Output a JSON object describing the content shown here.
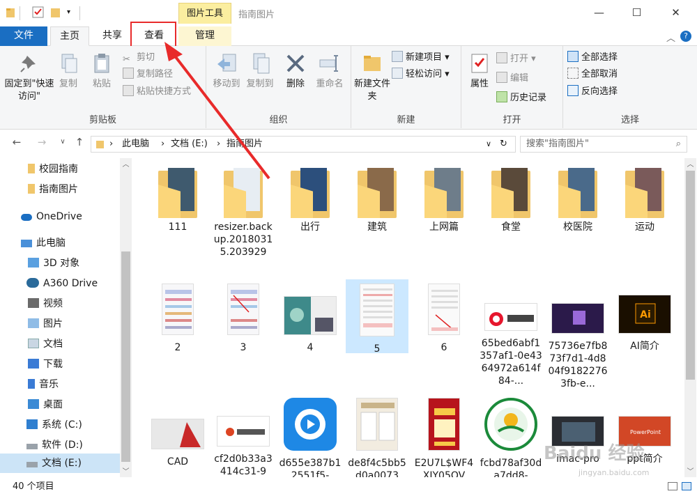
{
  "title_bar": {
    "context_tab": "图片工具",
    "window_title": "指南图片",
    "minimize": "—",
    "maximize": "☐",
    "close": "✕"
  },
  "tabs": {
    "file": "文件",
    "home": "主页",
    "share": "共享",
    "view": "查看",
    "manage": "管理"
  },
  "ribbon": {
    "clipboard": {
      "label": "剪贴板",
      "pin": "固定到\"快速访问\"",
      "copy": "复制",
      "paste": "粘贴",
      "cut": "剪切",
      "copy_path": "复制路径",
      "paste_shortcut": "粘贴快捷方式"
    },
    "organize": {
      "label": "组织",
      "move_to": "移动到",
      "copy_to": "复制到",
      "delete": "删除",
      "rename": "重命名"
    },
    "new": {
      "label": "新建",
      "new_folder": "新建文件夹",
      "new_item": "新建项目",
      "easy_access": "轻松访问"
    },
    "open": {
      "label": "打开",
      "properties": "属性",
      "open": "打开",
      "edit": "编辑",
      "history": "历史记录"
    },
    "select": {
      "label": "选择",
      "select_all": "全部选择",
      "select_none": "全部取消",
      "invert": "反向选择"
    }
  },
  "address": {
    "crumbs": [
      "此电脑",
      "文档 (E:)",
      "指南图片"
    ],
    "search_placeholder": "搜索\"指南图片\""
  },
  "nav": [
    {
      "label": "校园指南",
      "icon": "folder-icon"
    },
    {
      "label": "指南图片",
      "icon": "folder-icon"
    },
    {
      "label": "OneDrive",
      "icon": "cloud-icon"
    },
    {
      "label": "此电脑",
      "icon": "computer-icon"
    },
    {
      "label": "3D 对象",
      "icon": "3d-objects-icon"
    },
    {
      "label": "A360 Drive",
      "icon": "a360-icon"
    },
    {
      "label": "视频",
      "icon": "video-icon"
    },
    {
      "label": "图片",
      "icon": "pictures-icon"
    },
    {
      "label": "文档",
      "icon": "documents-icon"
    },
    {
      "label": "下载",
      "icon": "downloads-icon"
    },
    {
      "label": "音乐",
      "icon": "music-icon"
    },
    {
      "label": "桌面",
      "icon": "desktop-icon"
    },
    {
      "label": "系统 (C:)",
      "icon": "drive-icon"
    },
    {
      "label": "软件 (D:)",
      "icon": "drive-icon"
    },
    {
      "label": "文档 (E:)",
      "icon": "drive-icon"
    }
  ],
  "items_row1": [
    "111",
    "resizer.backup.20180315.203929",
    "出行",
    "建筑",
    "上网篇",
    "食堂",
    "校医院",
    "运动"
  ],
  "items_row2": [
    "2",
    "3",
    "4",
    "5",
    "6",
    "65bed6abf1357af1-0e4364972a614f84-...",
    "75736e7fb873f7d1-4d804f91822763fb-e...",
    "AI简介"
  ],
  "items_row3": [
    "CAD",
    "cf2d0b33a3414c31-9",
    "d655e387b12551f5-",
    "de8f4c5bb5d0a0073",
    "E2U7L$WF4XIY05OV",
    "fcbd78af30da7dd8-",
    "imac-pro",
    "ppt简介"
  ],
  "status": {
    "count": "40 个项目"
  },
  "watermark": {
    "logo": "Baidu 经验",
    "url": "jingyan.baidu.com"
  },
  "colors": {
    "file_tab": "#1a6ec2",
    "highlight": "#e82a2a",
    "selection": "#cce8ff",
    "folder": "#f0c66b"
  }
}
